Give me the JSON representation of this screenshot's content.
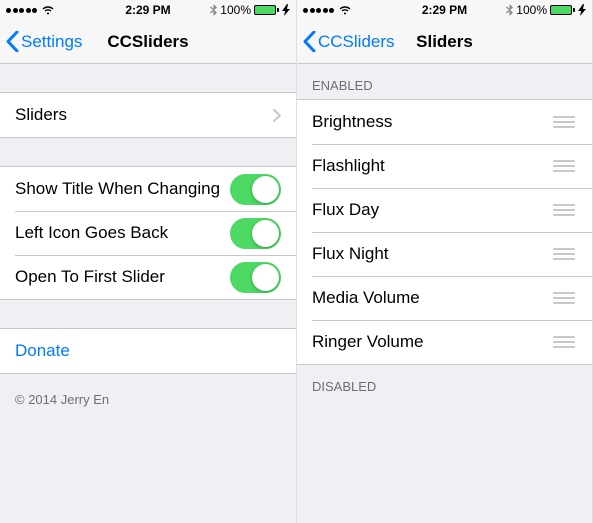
{
  "status": {
    "time": "2:29 PM",
    "battery_pct": "100%"
  },
  "left": {
    "nav": {
      "back": "Settings",
      "title": "CCSliders"
    },
    "rows": {
      "sliders": "Sliders",
      "show_title": "Show Title When Changing",
      "left_icon": "Left Icon Goes Back",
      "open_first": "Open To First Slider",
      "donate": "Donate"
    },
    "toggles": {
      "show_title": true,
      "left_icon": true,
      "open_first": true
    },
    "footer": "© 2014 Jerry En"
  },
  "right": {
    "nav": {
      "back": "CCSliders",
      "title": "Sliders"
    },
    "sections": {
      "enabled_header": "ENABLED",
      "disabled_header": "DISABLED"
    },
    "enabled": [
      "Brightness",
      "Flashlight",
      "Flux Day",
      "Flux Night",
      "Media Volume",
      "Ringer Volume"
    ],
    "disabled": []
  }
}
